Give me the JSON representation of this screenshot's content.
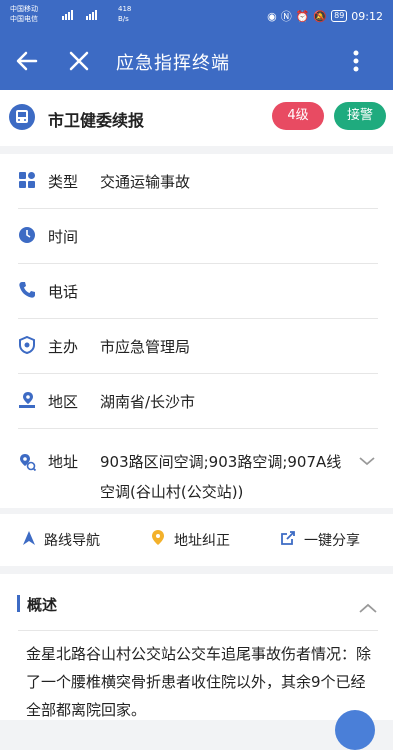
{
  "status_bar": {
    "carrier1": "中国移动",
    "carrier2": "中国电信",
    "speed_value": "418",
    "speed_unit": "B/s",
    "battery": "89",
    "time": "09:12"
  },
  "app_bar": {
    "title": "应急指挥终端"
  },
  "header": {
    "title": "市卫健委续报",
    "level_badge": "4级",
    "accept_button": "接警"
  },
  "info": {
    "type_label": "类型",
    "type_value": "交通运输事故",
    "time_label": "时间",
    "phone_label": "电话",
    "host_label": "主办",
    "host_value": "市应急管理局",
    "region_label": "地区",
    "region_value": "湖南省/长沙市",
    "address_label": "地址",
    "address_value": "903路区间空调;903路空调;907A线空调(谷山村(公交站))"
  },
  "actions": {
    "nav_label": "路线导航",
    "fix_label": "地址纠正",
    "share_label": "一键分享"
  },
  "summary": {
    "title": "概述",
    "text": "金星北路谷山村公交站公交车追尾事故伤者情况：除了一个腰椎横突骨折患者收住院以外，其余9个已经全部都离院回家。"
  },
  "colors": {
    "primary": "#3d6bc4",
    "badge_red": "#e84b62",
    "badge_green": "#1fab7e"
  }
}
